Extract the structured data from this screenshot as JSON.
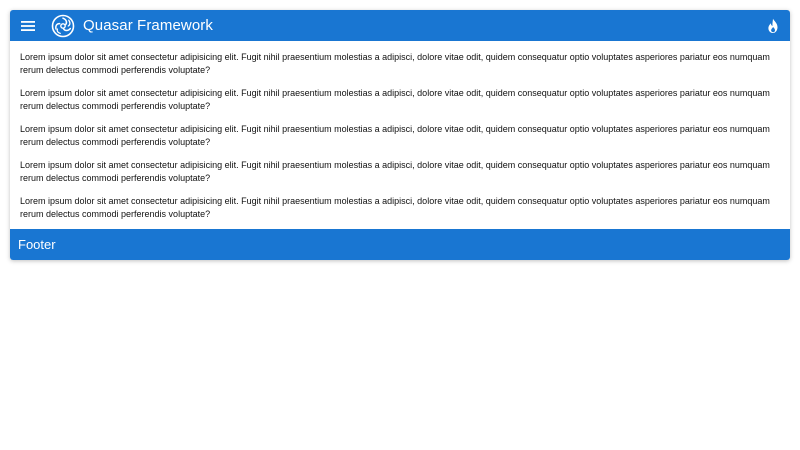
{
  "header": {
    "title": "Quasar Framework",
    "menu_icon": "menu-icon",
    "logo_icon": "quasar-logo-icon",
    "action_icon": "fire-icon"
  },
  "content": {
    "paragraphs": [
      "Lorem ipsum dolor sit amet consectetur adipisicing elit. Fugit nihil praesentium molestias a adipisci, dolore vitae odit, quidem consequatur optio voluptates asperiores pariatur eos numquam rerum delectus commodi perferendis voluptate?",
      "Lorem ipsum dolor sit amet consectetur adipisicing elit. Fugit nihil praesentium molestias a adipisci, dolore vitae odit, quidem consequatur optio voluptates asperiores pariatur eos numquam rerum delectus commodi perferendis voluptate?",
      "Lorem ipsum dolor sit amet consectetur adipisicing elit. Fugit nihil praesentium molestias a adipisci, dolore vitae odit, quidem consequatur optio voluptates asperiores pariatur eos numquam rerum delectus commodi perferendis voluptate?",
      "Lorem ipsum dolor sit amet consectetur adipisicing elit. Fugit nihil praesentium molestias a adipisci, dolore vitae odit, quidem consequatur optio voluptates asperiores pariatur eos numquam rerum delectus commodi perferendis voluptate?",
      "Lorem ipsum dolor sit amet consectetur adipisicing elit. Fugit nihil praesentium molestias a adipisci, dolore vitae odit, quidem consequatur optio voluptates asperiores pariatur eos numquam rerum delectus commodi perferendis voluptate?"
    ]
  },
  "footer": {
    "label": "Footer"
  },
  "colors": {
    "primary": "#1976d2",
    "background": "#ffffff",
    "text": "#111111"
  }
}
